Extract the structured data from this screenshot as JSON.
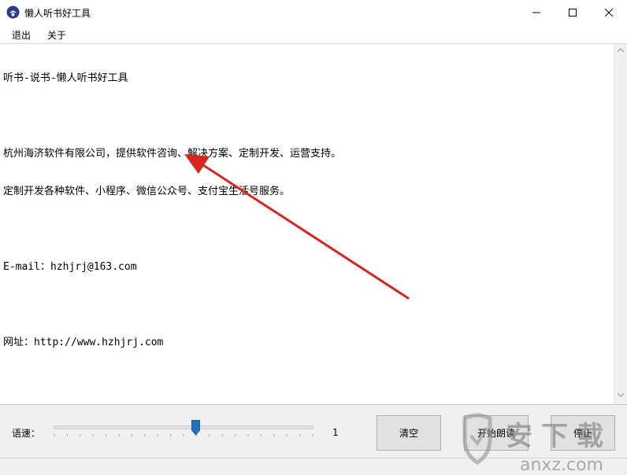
{
  "window": {
    "title": "懒人听书好工具",
    "minimize_icon": "minimize-icon",
    "maximize_icon": "maximize-icon",
    "close_icon": "close-icon"
  },
  "menu": {
    "exit": "退出",
    "about": "关于"
  },
  "content": {
    "lines": [
      "听书-说书-懒人听书好工具",
      "",
      "杭州海济软件有限公司，提供软件咨询、解决方案、定制开发、运营支持。",
      "定制开发各种软件、小程序、微信公众号、支付宝生活号服务。",
      "",
      "E-mail：hzhjrj@163.com",
      "",
      "网址：http://www.hzhjrj.com"
    ]
  },
  "controls": {
    "speed_label": "语速：",
    "speed_value": "1",
    "speed_min": -10,
    "speed_max": 10,
    "speed_current": 1,
    "clear_label": "清空",
    "start_label": "开始朗读",
    "stop_label": "停止"
  },
  "watermark": {
    "chars": [
      "安",
      "下",
      "载"
    ],
    "domain": "anxz.com"
  },
  "colors": {
    "accent": "#1e73be",
    "arrow": "#d9251d",
    "watermark": "#8c8c8c"
  }
}
